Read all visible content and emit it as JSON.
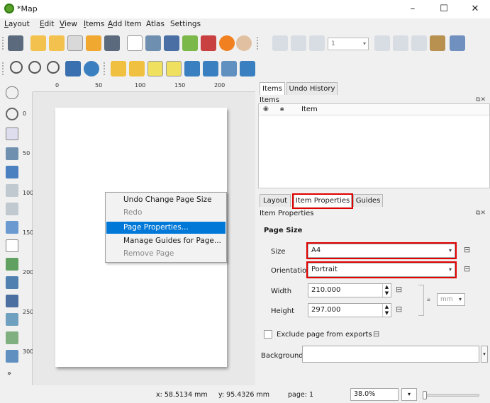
{
  "window": {
    "title": "*Map",
    "min": "–",
    "max": "☐",
    "close": "✕"
  },
  "menubar": [
    {
      "label": "Layout",
      "u": "L"
    },
    {
      "label": "Edit",
      "u": "E"
    },
    {
      "label": "View",
      "u": "V"
    },
    {
      "label": "Items",
      "u": "I"
    },
    {
      "label": "Add Item",
      "u": "A"
    },
    {
      "label": "Atlas",
      "u": ""
    },
    {
      "label": "Settings",
      "u": ""
    }
  ],
  "toolbar": {
    "atlas_page": "1"
  },
  "ruler": {
    "top": [
      "0",
      "50",
      "100",
      "150",
      "200"
    ],
    "left": [
      "0",
      "50",
      "100",
      "150",
      "200",
      "250",
      "300"
    ]
  },
  "context_menu": {
    "items": [
      {
        "label": "Undo Change Page Size",
        "state": "normal"
      },
      {
        "label": "Redo",
        "state": "disabled"
      },
      {
        "label": "Page Properties...",
        "state": "highlighted"
      },
      {
        "label": "Manage Guides for Page...",
        "state": "normal"
      },
      {
        "label": "Remove Page",
        "state": "disabled"
      }
    ]
  },
  "items_panel": {
    "tabs": [
      "Items",
      "Undo History"
    ],
    "title": "Items",
    "column": "Item"
  },
  "props_panel": {
    "tabs": [
      "Layout",
      "Item Properties",
      "Guides"
    ],
    "title": "Item Properties",
    "section": "Page Size",
    "size_label": "Size",
    "size_value": "A4",
    "orientation_label": "Orientation",
    "orientation_value": "Portrait",
    "width_label": "Width",
    "width_value": "210.000",
    "height_label": "Height",
    "height_value": "297.000",
    "unit": "mm",
    "exclude_label": "Exclude page from exports",
    "background_label": "Background"
  },
  "status": {
    "x": "x: 58.5134 mm",
    "y": "y: 95.4326 mm",
    "page": "page: 1",
    "zoom": "38.0%"
  },
  "colors": {
    "highlight": "#0078d7",
    "annotation_red": "#e00000"
  }
}
